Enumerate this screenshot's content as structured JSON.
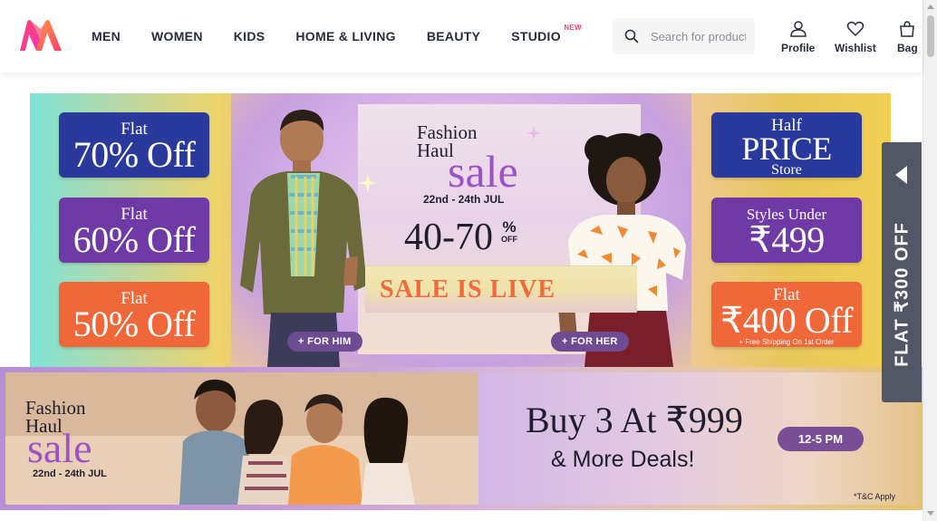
{
  "brand": {
    "logo_alt": "Myntra",
    "accent": "#ff3f6c"
  },
  "nav": {
    "items": [
      {
        "label": "MEN"
      },
      {
        "label": "WOMEN"
      },
      {
        "label": "KIDS"
      },
      {
        "label": "HOME & LIVING"
      },
      {
        "label": "BEAUTY"
      },
      {
        "label": "STUDIO",
        "badge": "NEW"
      }
    ]
  },
  "search": {
    "placeholder": "Search for products, brands and more",
    "icon": "search-icon"
  },
  "actions": [
    {
      "label": "Profile",
      "icon": "profile-icon"
    },
    {
      "label": "Wishlist",
      "icon": "heart-icon"
    },
    {
      "label": "Bag",
      "icon": "bag-icon"
    }
  ],
  "banner1": {
    "left_tiles": [
      {
        "small": "Flat",
        "big": "70% Off"
      },
      {
        "small": "Flat",
        "big": "60% Off"
      },
      {
        "small": "Flat",
        "big": "50% Off"
      }
    ],
    "right_tiles": [
      {
        "small": "Half",
        "big": "PRICE",
        "small2": "Store"
      },
      {
        "small": "Styles Under",
        "big": "₹499"
      },
      {
        "small": "Flat",
        "big": "₹400 Off",
        "note": "+ Free Shipping On 1st Order"
      }
    ],
    "title_line1": "Fashion",
    "title_line2": "Haul",
    "title_sale": "sale",
    "dates": "22nd - 24th JUL",
    "discount": "40-70",
    "discount_pct": "%",
    "discount_off": "OFF",
    "live": "SALE IS LIVE",
    "cta_him": "+ FOR HIM",
    "cta_her": "+ FOR HER"
  },
  "side_tab": {
    "label": "FLAT ₹300 OFF"
  },
  "banner2": {
    "title_line1": "Fashion",
    "title_line2": "Haul",
    "title_sale": "sale",
    "dates": "22nd - 24th JUL",
    "headline": "Buy 3 At ₹999",
    "subline": "& More Deals!",
    "time_pill": "12-5 PM",
    "tc": "*T&C Apply"
  },
  "colors": {
    "tile_blue": "#2a3a9c",
    "tile_purple": "#6f3aa6",
    "tile_orange": "#f0683a",
    "sale_purple": "#9b53c6",
    "side_tab": "#535665"
  }
}
